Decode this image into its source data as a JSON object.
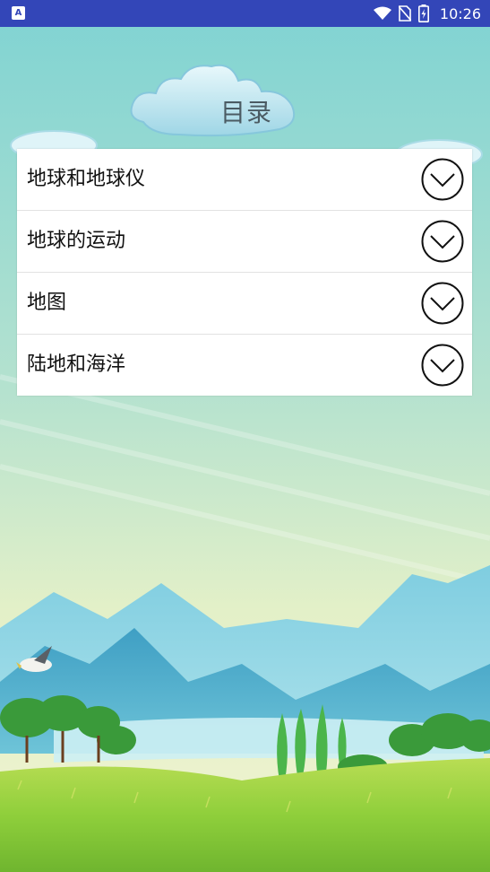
{
  "status_bar": {
    "app_icon_letter": "A",
    "time": "10:26",
    "icons": [
      "wifi-icon",
      "no-sim-icon",
      "battery-charging-icon"
    ]
  },
  "page": {
    "title": "目录"
  },
  "menu": {
    "items": [
      {
        "label": "地球和地球仪",
        "icon": "chevron-down-circle-icon"
      },
      {
        "label": "地球的运动",
        "icon": "chevron-down-circle-icon"
      },
      {
        "label": "地图",
        "icon": "chevron-down-circle-icon"
      },
      {
        "label": "陆地和海洋",
        "icon": "chevron-down-circle-icon"
      }
    ]
  },
  "colors": {
    "status_bar": "#3346b8",
    "sky_top": "#7fd3d3",
    "sky_bottom": "#e6f1c8",
    "grass": "#8fcf3b",
    "mountains": "#4fb3c9"
  }
}
